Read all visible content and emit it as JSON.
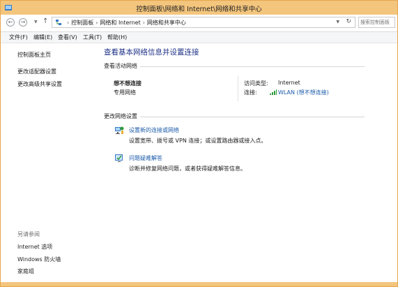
{
  "window": {
    "title": "控制面板\\网络和 Internet\\网络和共享中心",
    "accent": "#f3c57d"
  },
  "address": {
    "crumbs": [
      "控制面板",
      "网络和 Internet",
      "网络和共享中心"
    ],
    "search_placeholder": "搜索控制面板"
  },
  "menu": {
    "items": [
      "文件(F)",
      "编辑(E)",
      "查看(V)",
      "工具(T)",
      "帮助(H)"
    ]
  },
  "sidebar": {
    "links": [
      "控制面板主页",
      "更改适配器设置",
      "更改高级共享设置"
    ],
    "see_also_title": "另请参阅",
    "see_also": [
      "Internet 选项",
      "Windows 防火墙",
      "家庭组"
    ]
  },
  "main": {
    "title": "查看基本网络信息并设置连接",
    "active_networks_header": "查看活动网络",
    "network": {
      "name": "想不想连接",
      "type": "专用网络",
      "access_type_label": "访问类型:",
      "access_type_value": "Internet",
      "connection_label": "连接:",
      "connection_value": "WLAN (想不想连接)"
    },
    "change_settings_header": "更改网络设置",
    "tasks": [
      {
        "icon": "network-setup-icon",
        "link": "设置新的连接或网络",
        "desc": "设置宽带、拨号或 VPN 连接；或设置路由器或接入点。"
      },
      {
        "icon": "troubleshoot-icon",
        "link": "问题疑难解答",
        "desc": "诊断并修复网络问题，或者获得疑难解答信息。"
      }
    ]
  },
  "colors": {
    "link": "#1a5aa8",
    "title": "#1e3287"
  }
}
